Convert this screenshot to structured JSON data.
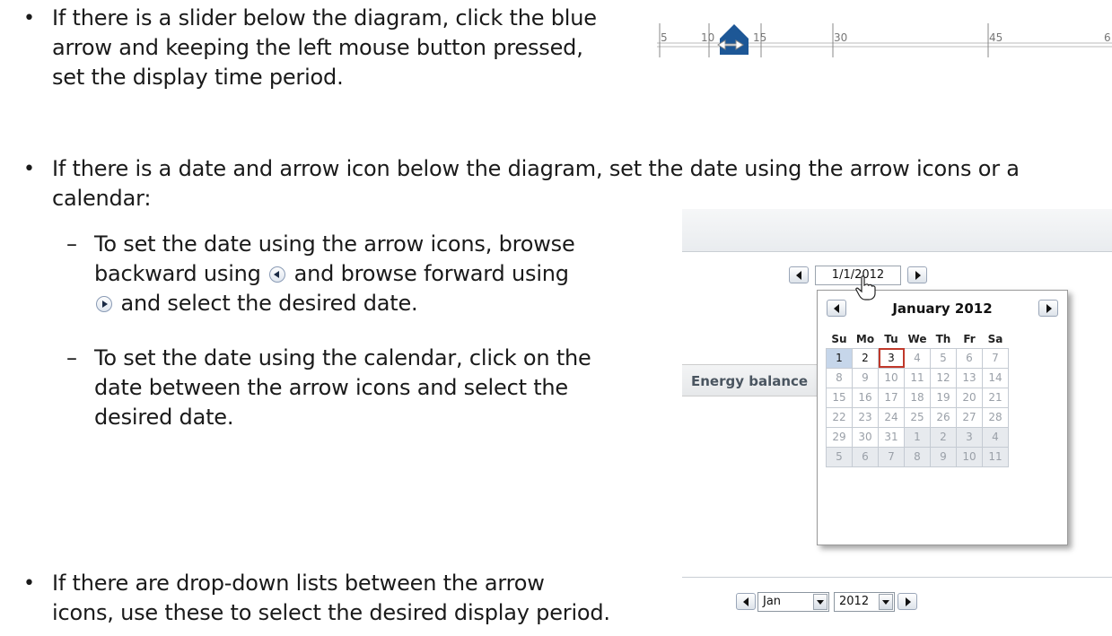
{
  "instructions": {
    "slider_bullet": [
      "If there is a slider below the diagram, click the blue",
      "arrow and keeping the left mouse button pressed,",
      "set the display time period."
    ],
    "date_bullet": [
      "If there is a date and arrow icon below the diagram, set the date using the arrow icons or a",
      "calendar:"
    ],
    "arrow_sub": {
      "line1": "To set the date using the arrow icons, browse",
      "line2_pre": "backward using",
      "line2_post": "and browse forward using",
      "line3_post": "and select the desired date."
    },
    "calendar_sub": [
      "To set the date using the calendar, click on the",
      "date between the arrow icons and select the",
      "desired date."
    ],
    "dropdown_bullet": [
      "If there are drop-down lists between the arrow",
      "icons, use these to select the desired display period."
    ]
  },
  "slider": {
    "tick_labels": [
      "5",
      "10",
      "15",
      "30",
      "45",
      "6"
    ],
    "handle_color": "#1d5796"
  },
  "calendar_widget": {
    "date_value": "1/1/2012",
    "month_title": "January 2012",
    "tab_label": "Energy balance",
    "weekdays": [
      "Su",
      "Mo",
      "Tu",
      "We",
      "Th",
      "Fr",
      "Sa"
    ],
    "weeks": [
      [
        "1",
        "2",
        "3",
        "4",
        "5",
        "6",
        "7"
      ],
      [
        "8",
        "9",
        "10",
        "11",
        "12",
        "13",
        "14"
      ],
      [
        "15",
        "16",
        "17",
        "18",
        "19",
        "20",
        "21"
      ],
      [
        "22",
        "23",
        "24",
        "25",
        "26",
        "27",
        "28"
      ],
      [
        "29",
        "30",
        "31",
        "1",
        "2",
        "3",
        "4"
      ],
      [
        "5",
        "6",
        "7",
        "8",
        "9",
        "10",
        "11"
      ]
    ],
    "selected_day": "1",
    "highlighted_day": "3",
    "today_outline_color": "#c0392b"
  },
  "dropdown_widget": {
    "month_value": "Jan",
    "year_value": "2012"
  }
}
